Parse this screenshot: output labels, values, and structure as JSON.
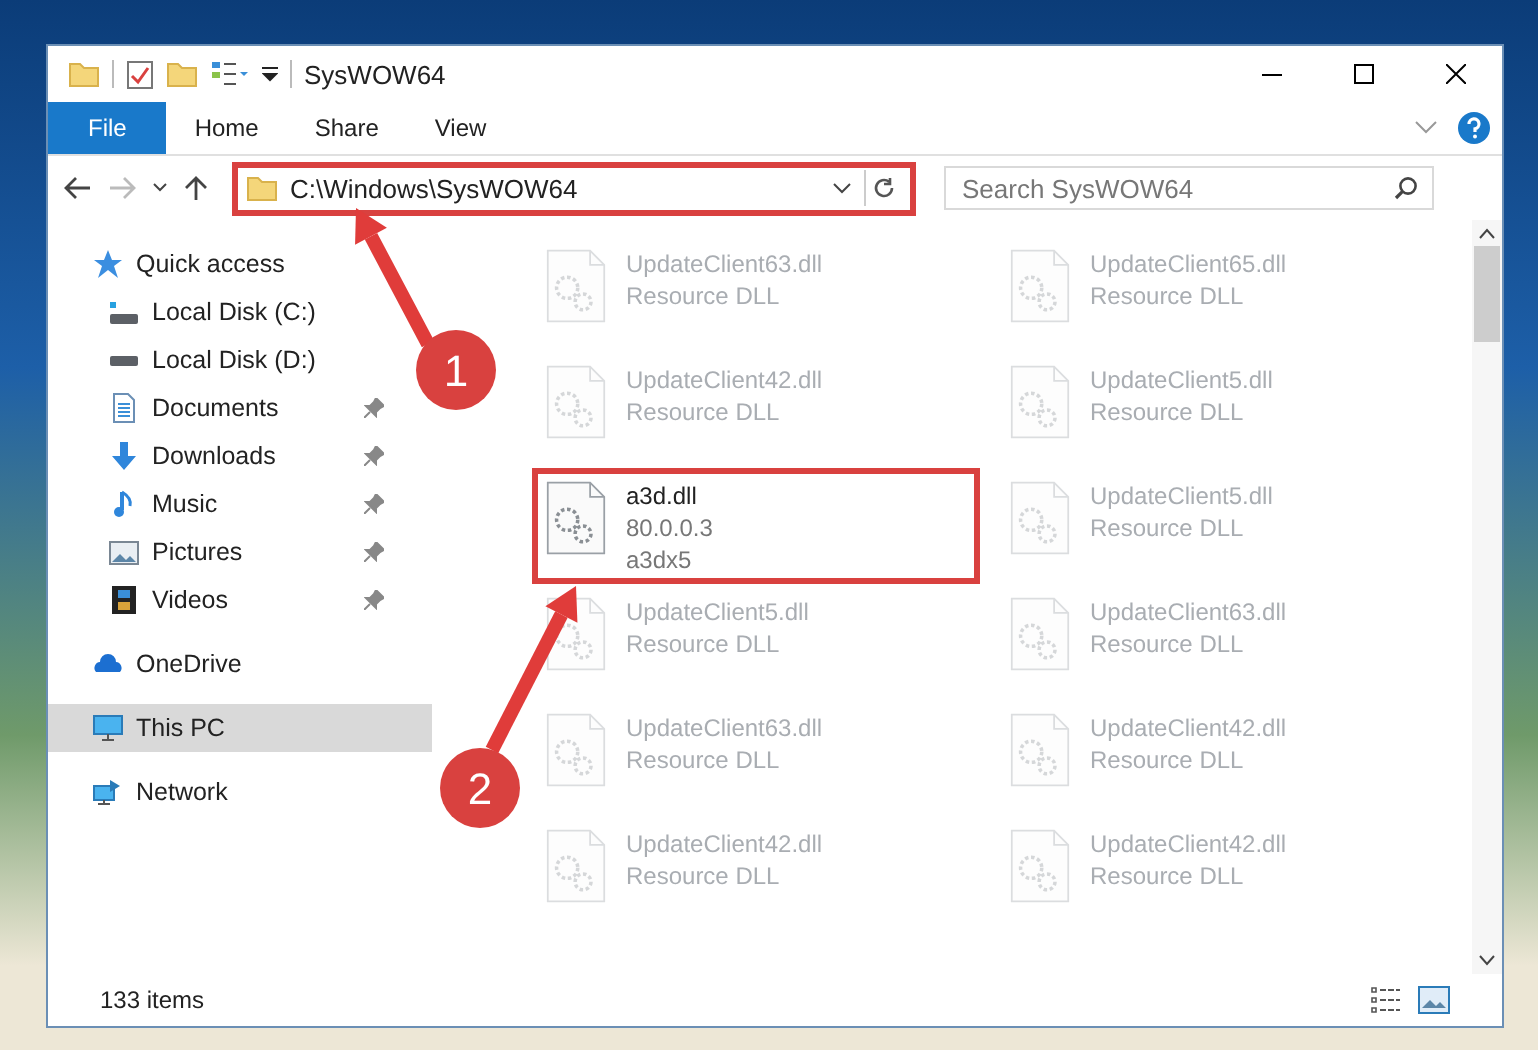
{
  "window": {
    "title": "SysWOW64"
  },
  "ribbon_tabs": [
    {
      "label": "File",
      "selected": true
    },
    {
      "label": "Home",
      "selected": false
    },
    {
      "label": "Share",
      "selected": false
    },
    {
      "label": "View",
      "selected": false
    }
  ],
  "address_bar": {
    "path": "C:\\Windows\\SysWOW64",
    "highlighted": true
  },
  "search": {
    "placeholder": "Search SysWOW64"
  },
  "sidebar": {
    "items": [
      {
        "label": "Quick access",
        "kind": "star",
        "selected": false,
        "children": [
          {
            "label": "Local Disk (C:)",
            "kind": "disk-c",
            "pinned": false
          },
          {
            "label": "Local Disk (D:)",
            "kind": "disk",
            "pinned": false
          },
          {
            "label": "Documents",
            "kind": "documents",
            "pinned": true
          },
          {
            "label": "Downloads",
            "kind": "downloads",
            "pinned": true
          },
          {
            "label": "Music",
            "kind": "music",
            "pinned": true
          },
          {
            "label": "Pictures",
            "kind": "pictures",
            "pinned": true
          },
          {
            "label": "Videos",
            "kind": "videos",
            "pinned": true
          }
        ]
      },
      {
        "label": "OneDrive",
        "kind": "cloud",
        "selected": false
      },
      {
        "label": "This PC",
        "kind": "pc",
        "selected": true
      },
      {
        "label": "Network",
        "kind": "network",
        "selected": false
      }
    ]
  },
  "files": [
    {
      "name": "UpdateClient63.dll",
      "lines": [
        "Resource DLL"
      ],
      "faded": true,
      "highlighted": false
    },
    {
      "name": "UpdateClient65.dll",
      "lines": [
        "Resource DLL"
      ],
      "faded": true,
      "highlighted": false
    },
    {
      "name": "UpdateClient42.dll",
      "lines": [
        "Resource DLL"
      ],
      "faded": true,
      "highlighted": false
    },
    {
      "name": "UpdateClient5.dll",
      "lines": [
        "Resource DLL"
      ],
      "faded": true,
      "highlighted": false
    },
    {
      "name": "a3d.dll",
      "lines": [
        "80.0.0.3",
        "a3dx5"
      ],
      "faded": false,
      "highlighted": true
    },
    {
      "name": "UpdateClient5.dll",
      "lines": [
        "Resource DLL"
      ],
      "faded": true,
      "highlighted": false
    },
    {
      "name": "UpdateClient5.dll",
      "lines": [
        "Resource DLL"
      ],
      "faded": true,
      "highlighted": false
    },
    {
      "name": "UpdateClient63.dll",
      "lines": [
        "Resource DLL"
      ],
      "faded": true,
      "highlighted": false
    },
    {
      "name": "UpdateClient63.dll",
      "lines": [
        "Resource DLL"
      ],
      "faded": true,
      "highlighted": false
    },
    {
      "name": "UpdateClient42.dll",
      "lines": [
        "Resource DLL"
      ],
      "faded": true,
      "highlighted": false
    },
    {
      "name": "UpdateClient42.dll",
      "lines": [
        "Resource DLL"
      ],
      "faded": true,
      "highlighted": false
    },
    {
      "name": "UpdateClient42.dll",
      "lines": [
        "Resource DLL"
      ],
      "faded": true,
      "highlighted": false
    }
  ],
  "callouts": [
    {
      "number": "1"
    },
    {
      "number": "2"
    }
  ],
  "status_bar": {
    "count": "133 items"
  }
}
